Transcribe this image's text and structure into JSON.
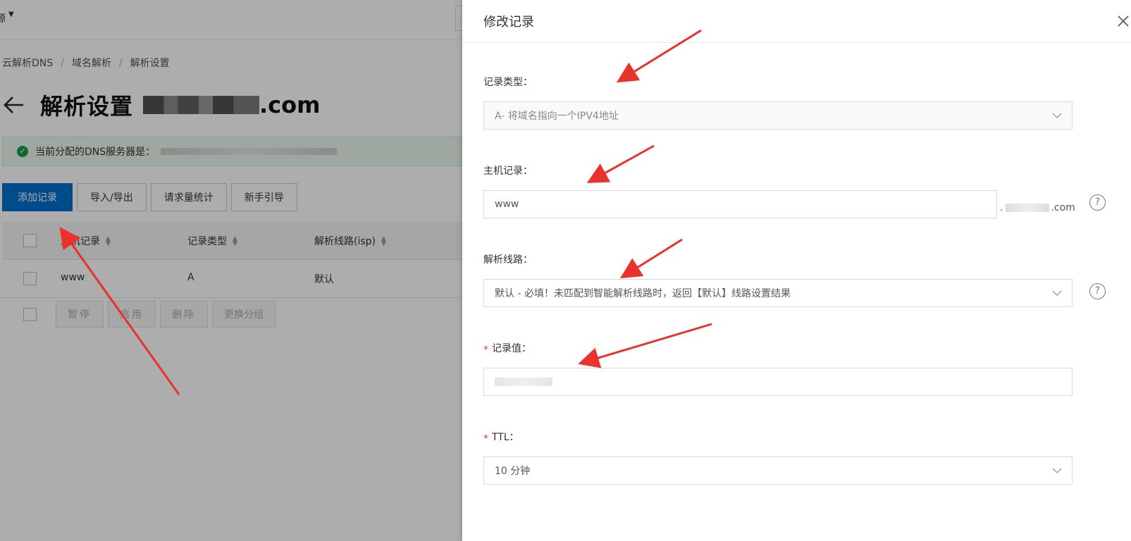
{
  "topbar": {
    "label": "源"
  },
  "breadcrumb": [
    "云解析DNS",
    "域名解析",
    "解析设置"
  ],
  "page": {
    "title": "解析设置",
    "domain_suffix": ".com"
  },
  "dns_alert": {
    "text": "当前分配的DNS服务器是："
  },
  "toolbar": {
    "add": "添加记录",
    "import_export": "导入/导出",
    "stats": "请求量统计",
    "guide": "新手引导"
  },
  "table": {
    "headers": [
      "主机记录",
      "记录类型",
      "解析线路(isp)"
    ],
    "rows": [
      {
        "host": "www",
        "type": "A",
        "line": "默认"
      }
    ]
  },
  "batch": {
    "pause": "暂停",
    "enable": "启用",
    "delete": "删除",
    "change_group": "更换分组"
  },
  "drawer": {
    "title": "修改记录",
    "record_type": {
      "label": "记录类型：",
      "value": "A- 将域名指向一个IPV4地址"
    },
    "host_record": {
      "label": "主机记录：",
      "value": "www",
      "suffix": ".com"
    },
    "line": {
      "label": "解析线路：",
      "value": "默认 - 必填！未匹配到智能解析线路时，返回【默认】线路设置结果"
    },
    "record_value": {
      "label": "记录值：",
      "required_mark": "*"
    },
    "ttl": {
      "label": "TTL：",
      "required_mark": "*",
      "value": "10 分钟"
    }
  },
  "colors": {
    "primary": "#0070cc",
    "annotation_arrow": "#e8322b",
    "success": "#1a9a4b",
    "required": "#e4393c"
  }
}
